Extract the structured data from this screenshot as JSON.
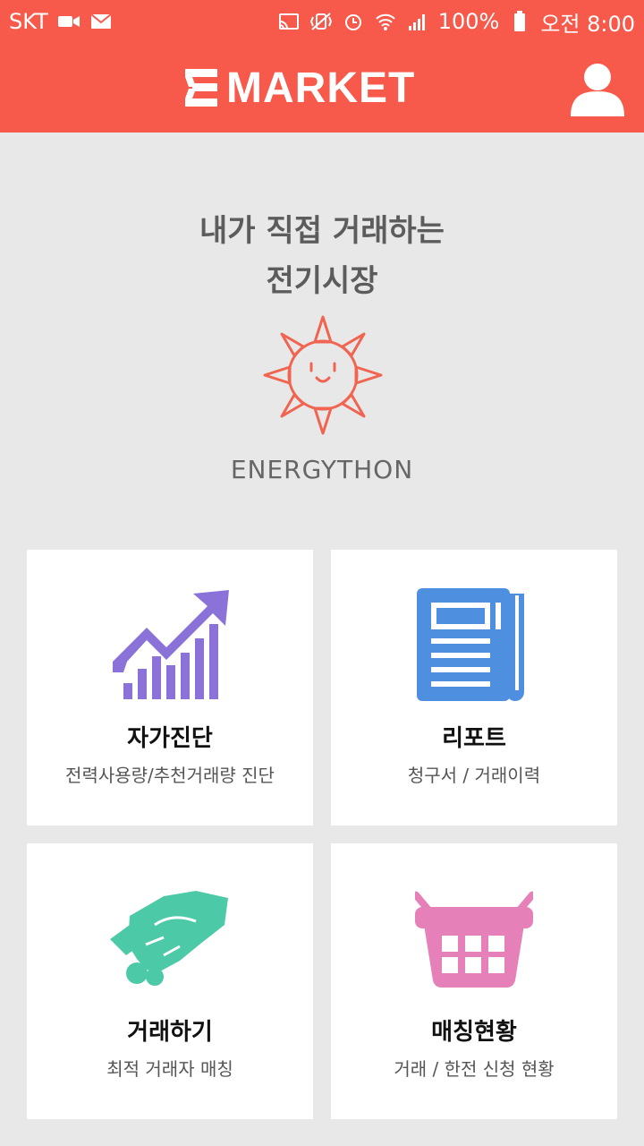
{
  "status_bar": {
    "carrier": "SKT",
    "battery": "100%",
    "time": "오전 8:00",
    "left_icons": [
      "video-icon",
      "mail-icon"
    ],
    "right_icons": [
      "cast-icon",
      "vibrate-icon",
      "alarm-icon",
      "wifi-icon",
      "signal-icon",
      "battery-icon"
    ]
  },
  "app_bar": {
    "brand": "MARKET",
    "brand_mark": "E",
    "profile_icon": "person-icon"
  },
  "hero": {
    "tagline_line1": "내가 직접 거래하는",
    "tagline_line2": "전기시장",
    "logo_icon": "sun-icon",
    "caption": "ENERGYTHON"
  },
  "cards": [
    {
      "title": "자가진단",
      "subtitle": "전력사용량/추천거래량 진단",
      "icon": "growth-chart-icon",
      "color": "#8b72d8"
    },
    {
      "title": "리포트",
      "subtitle": "청구서 / 거래이력",
      "icon": "newspaper-icon",
      "color": "#4f8fe0"
    },
    {
      "title": "거래하기",
      "subtitle": "최적 거래자 매칭",
      "icon": "handshake-icon",
      "color": "#4ccaa8"
    },
    {
      "title": "매칭현황",
      "subtitle": "거래 / 한전 신청 현황",
      "icon": "basket-icon",
      "color": "#e581b8"
    }
  ],
  "colors": {
    "accent": "#f7594a",
    "background": "#e8e8e8",
    "card": "#ffffff"
  }
}
